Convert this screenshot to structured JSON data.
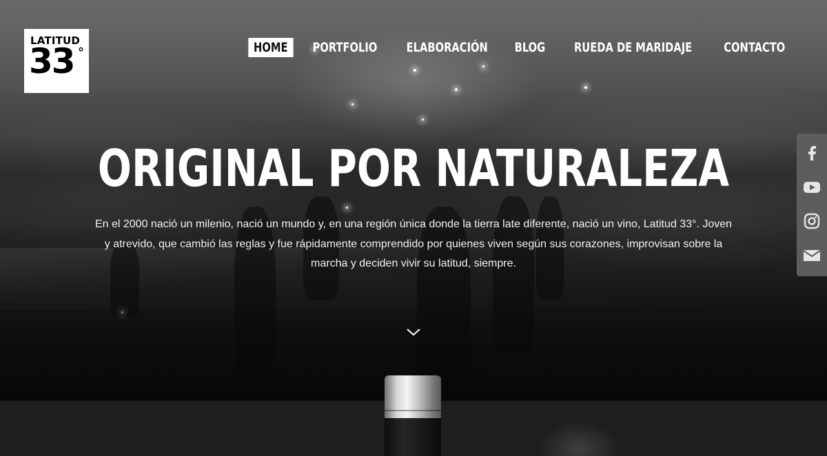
{
  "brand": {
    "logo_word": "LATITUD",
    "logo_number": "33",
    "logo_degree": "°"
  },
  "nav": {
    "items": [
      {
        "label": "HOME",
        "active": true
      },
      {
        "label": "PORTFOLIO",
        "active": false
      },
      {
        "label": "ELABORACIÓN",
        "active": false
      },
      {
        "label": "BLOG",
        "active": false
      },
      {
        "label": "RUEDA DE MARIDAJE",
        "active": false
      },
      {
        "label": "CONTACTO",
        "active": false
      }
    ]
  },
  "hero": {
    "headline": "ORIGINAL POR NATURALEZA",
    "intro_line1": "En el 2000 nació un milenio, nació un mundo y, en una región única donde la tierra late diferente, nació un vino, Latitud 33°. Joven",
    "intro_line2": "y atrevido, que cambió las reglas y fue rápidamente comprendido por quienes viven según sus corazones, improvisan sobre la",
    "intro_line3": "marcha y deciden vivir su latitud, siempre.",
    "scroll_icon": "chevron-down-icon"
  },
  "social": {
    "icons": [
      "facebook-icon",
      "youtube-icon",
      "instagram-icon",
      "mail-icon"
    ]
  },
  "colors": {
    "social_bar": "#5d5d5d",
    "nav_active_bg": "#ffffff",
    "lower_section_bg": "#1e1e1e"
  }
}
